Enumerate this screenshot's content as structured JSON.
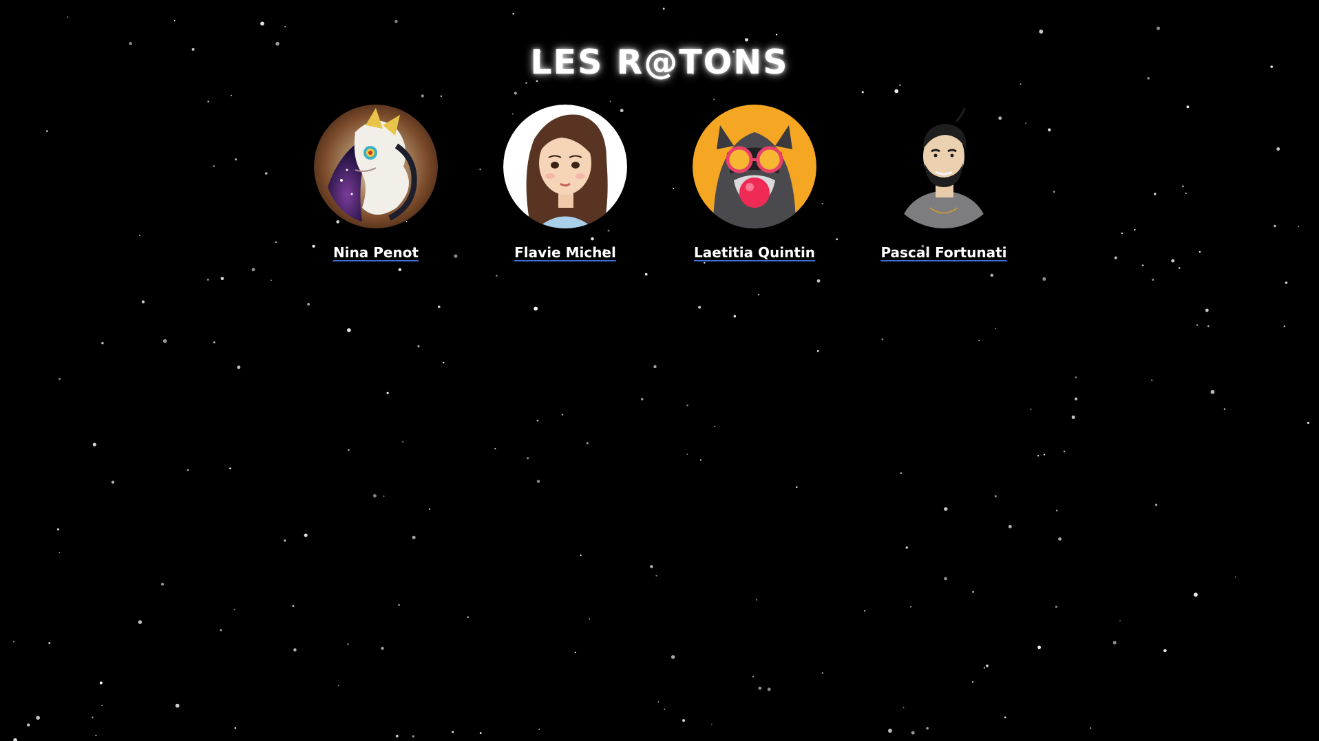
{
  "page": {
    "title": "LES R@TONS",
    "background_color": "#000000",
    "title_color": "#ffffff",
    "link_underline_color": "#3b6fd6"
  },
  "members": [
    {
      "name": "Nina Penot",
      "avatar_icon": "dragon-avatar-icon"
    },
    {
      "name": "Flavie Michel",
      "avatar_icon": "woman-avatar-icon"
    },
    {
      "name": "Laetitia Quintin",
      "avatar_icon": "raccoon-avatar-icon"
    },
    {
      "name": "Pascal Fortunati",
      "avatar_icon": "bearded-man-avatar-icon"
    }
  ]
}
